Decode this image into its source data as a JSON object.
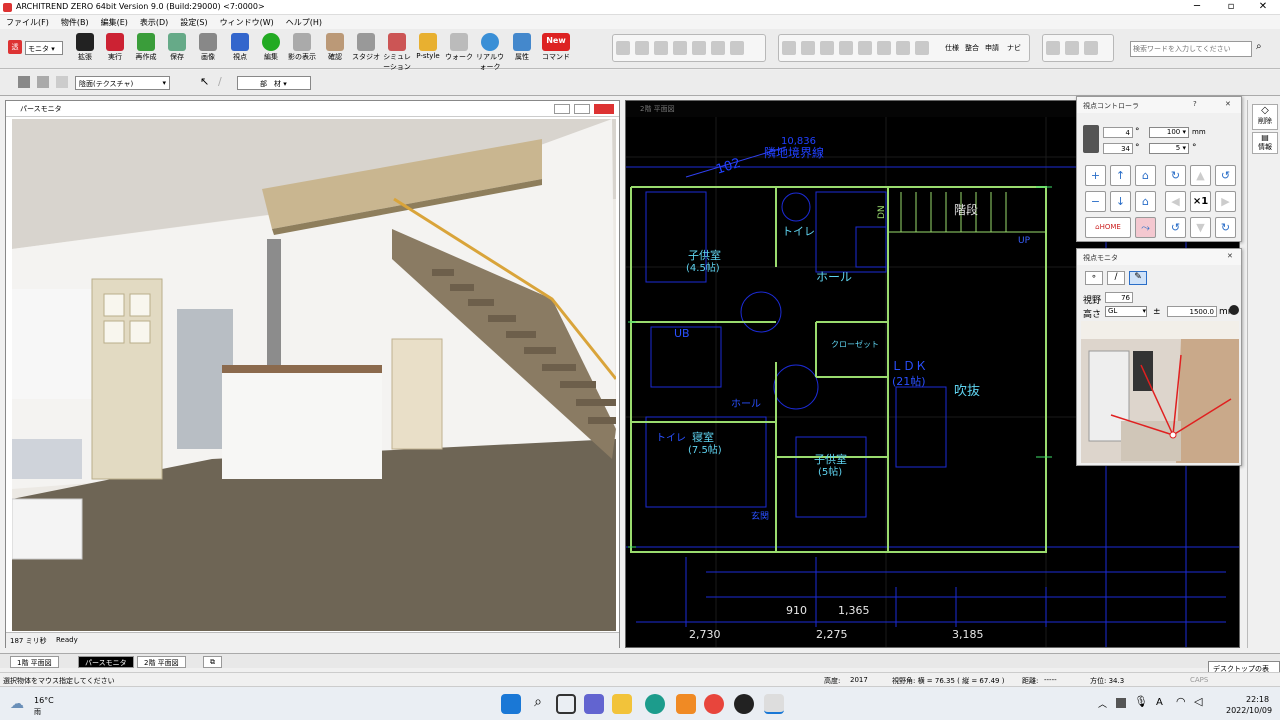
{
  "app": {
    "title": "ARCHITREND ZERO 64bit Version 9.0 (Build:29000) <7:0000>"
  },
  "menu": [
    "ファイル(F)",
    "物件(B)",
    "編集(E)",
    "表示(D)",
    "設定(S)",
    "ウィンドウ(W)",
    "ヘルプ(H)"
  ],
  "ribbon": {
    "mode_select": "モニタ",
    "buttons": [
      "拡張",
      "実行",
      "再作成",
      "保存",
      "画像",
      "視点",
      "編集",
      "影の表示",
      "確認",
      "スタジオ",
      "シミュレーション",
      "P-style",
      "ウォーク",
      "リアルウォーク",
      "属性",
      "コマンド"
    ],
    "new_badge": "New",
    "text_buttons": [
      "仕様",
      "整合",
      "申請",
      "ナビ"
    ],
    "search_placeholder": "検索ワードを入力してください"
  },
  "toolbar2": {
    "texture_select": "陰面(テクスチャ)",
    "parts_label": "部　材"
  },
  "pers": {
    "title": "パースモニタ",
    "status_left": "187 ミリ秒",
    "status_right": "Ready"
  },
  "plan": {
    "title": "2階 平面図",
    "labels": {
      "boundary": "隣地境界線",
      "boundary_dim": "10,836",
      "angle_dim": "102",
      "kids1": "子供室",
      "kids1_size": "(4.5帖)",
      "toilet": "トイレ",
      "hall": "ホール",
      "ub": "UB",
      "closet": "クローゼット",
      "ldk": "ＬＤＫ",
      "ldk_size": "(21帖)",
      "void": "吹抜",
      "stairs": "階段",
      "dn": "DN",
      "up": "UP",
      "bedroom": "寝室",
      "bedroom_size": "(7.5帖)",
      "kids2": "子供室",
      "kids2_size": "(5帖)",
      "hall2": "ホール",
      "toilet2": "トイレ",
      "porch": "玄関"
    },
    "dims_top": [
      "910",
      "1,365"
    ],
    "dims_bottom": [
      "2,730",
      "2,275",
      "3,185"
    ]
  },
  "viewpoint_controller": {
    "title": "視点コントローラ",
    "val1": "4",
    "val2": "34",
    "deg": "°",
    "val3": "100",
    "val3_unit": "mm",
    "val4": "5",
    "x1_label": "×1",
    "home_label": "HOME"
  },
  "viewpoint_monitor": {
    "title": "視点モニタ",
    "fov_label": "視野",
    "fov": "76",
    "height_label": "高さ",
    "ref": "GL",
    "pm": "±",
    "height": "1500.0",
    "unit": "mm"
  },
  "right_panel": {
    "delete": "削除",
    "info": "情報"
  },
  "tabs": [
    "1階 平面図",
    "パースモニタ",
    "2階 平面図"
  ],
  "statusbar": {
    "message": "選択物体をマウス指定してください",
    "height_label": "高度:",
    "height_val": "2017",
    "fov_text": "視野角: 横 = 76.35 ( 縦 = 67.49 )",
    "dist_label": "距離:",
    "dist_val": "-----",
    "azimuth": "方位: 34.3",
    "caps": "CAPS"
  },
  "tooltip": "デスクトップの表示",
  "taskbar": {
    "temp": "16°C",
    "weather": "雨",
    "lang": "A",
    "time": "22:18",
    "date": "2022/10/09"
  },
  "colors": {
    "plan_bg": "#000000",
    "plan_line": "#1c2bd6",
    "plan_wall": "#9adb6e",
    "plan_text": "#5fd3f0",
    "accent": "#2a6ec8"
  }
}
